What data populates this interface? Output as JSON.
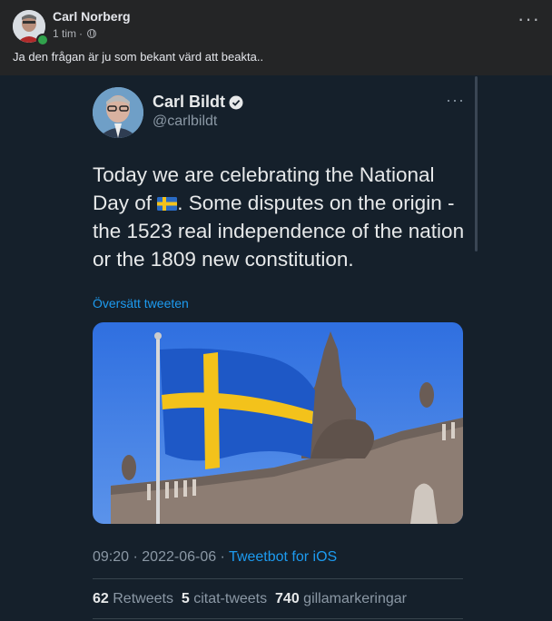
{
  "post": {
    "author": "Carl Norberg",
    "time": "1 tim",
    "separator": "·",
    "text": "Ja den frågan är ju som bekant värd att beakta.."
  },
  "tweet": {
    "name": "Carl Bildt",
    "handle": "@carlbildt",
    "text_before_flag": "Today we are celebrating the National Day of ",
    "flag_icon": "sweden-flag-emoji",
    "text_after_flag": ". Some disputes on the origin - the 1523 real independence of the nation or the 1809 new constitution.",
    "translate_link": "Översätt tweeten",
    "time": "09:20",
    "date": "2022-06-06",
    "via": "Tweetbot for iOS",
    "stats": {
      "retweets_count": "62",
      "retweets_label": "Retweets",
      "quotes_count": "5",
      "quotes_label": "citat-tweets",
      "likes_count": "740",
      "likes_label": "gillamarkeringar"
    }
  },
  "colors": {
    "facebook_bg": "#242526",
    "twitter_bg": "#15202b",
    "link_blue": "#1d9bf0",
    "flag_blue": "#2a6bc4",
    "flag_yellow": "#f3c21b"
  }
}
